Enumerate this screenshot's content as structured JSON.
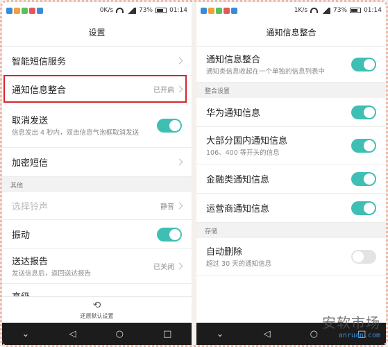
{
  "left": {
    "status": {
      "speed": "0K/s",
      "battery": "73%",
      "time": "01:14"
    },
    "title": "设置",
    "rows": [
      {
        "label": "智能短信服务"
      },
      {
        "label": "通知信息整合",
        "value": "已开启"
      },
      {
        "label": "取消发送",
        "sub": "信息发出 4 秒内，双击信息气泡框取消发送"
      },
      {
        "label": "加密短信"
      }
    ],
    "section_other": "其他",
    "rows2": [
      {
        "label": "选择铃声",
        "value": "静音"
      },
      {
        "label": "振动"
      },
      {
        "label": "送达报告",
        "sub": "发送信息后，返回送达报告",
        "value": "已关闭"
      },
      {
        "label": "高级"
      }
    ],
    "restore_label": "还原默认设置"
  },
  "right": {
    "status": {
      "speed": "1K/s",
      "battery": "73%",
      "time": "01:14"
    },
    "title": "通知信息整合",
    "row_main": {
      "label": "通知信息整合",
      "sub": "通知类信息收起在一个单独的信息列表中"
    },
    "section_settings": "整合设置",
    "rows": [
      {
        "label": "华为通知信息"
      },
      {
        "label": "大部分国内通知信息",
        "sub": "106、400 等开头的信息"
      },
      {
        "label": "金融类通知信息"
      },
      {
        "label": "运营商通知信息"
      }
    ],
    "section_storage": "存储",
    "auto_delete": {
      "label": "自动删除",
      "sub": "超过 30 天的通知信息"
    }
  },
  "watermark": {
    "line1": "安软市场",
    "line2": "anruan.com"
  },
  "colors": {
    "accent": "#3fbfb4",
    "highlight": "#d7262c"
  }
}
